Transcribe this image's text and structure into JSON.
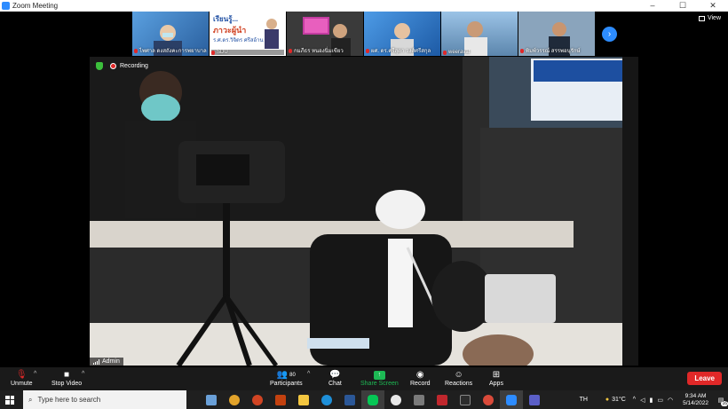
{
  "window": {
    "title": "Zoom Meeting",
    "controls": [
      "–",
      "☐",
      "✕"
    ]
  },
  "view_button": {
    "label": "View"
  },
  "participants_strip": [
    {
      "name": "ไพศาล ดงสถังคะการพยาบาล",
      "bg": "#3b7fc8"
    },
    {
      "name": "SDU",
      "bg": "#1f4fa3"
    },
    {
      "name": "กมภีธร หนองนิ่มเขียว",
      "bg": "#4a4a4a"
    },
    {
      "name": "ผศ. ดร.ศรีสุดา วงศ์ศรีสกุล",
      "bg": "#2e6fb5"
    },
    {
      "name": "weeravat",
      "bg": "#7aa0c8"
    },
    {
      "name": "พิมพ์วรรณ์ สรรพอนุรักษ์",
      "bg": "#5d7f9c"
    }
  ],
  "thumb_captions": [
    "เรียนรู้...",
    "ภาวะผู้นำ",
    "ร.ศ.ดร.วิจิตร ศรีสอ้าน"
  ],
  "speaker": {
    "recording_label": "Recording",
    "name_label": "Admin"
  },
  "toolbar": {
    "unmute": "Unmute",
    "stop_video": "Stop Video",
    "participants": "Participants",
    "participants_count": "80",
    "chat": "Chat",
    "share_screen": "Share Screen",
    "record": "Record",
    "reactions": "Reactions",
    "apps": "Apps",
    "leave": "Leave"
  },
  "taskbar": {
    "search_placeholder": "Type here to search",
    "language": "TH",
    "temperature": "31°C",
    "time": "9:34 AM",
    "date": "5/14/2022",
    "notification_count": "16"
  },
  "colors": {
    "accent": "#2d8cff",
    "leave": "#e02828",
    "share": "#1db954",
    "muted": "#e02828"
  }
}
